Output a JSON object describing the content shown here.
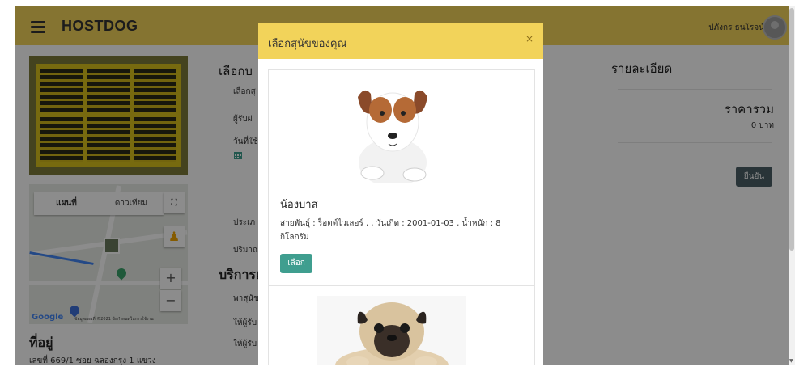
{
  "nav": {
    "brand": "HOSTDOG",
    "username": "ปภังกร ธนโรจน์"
  },
  "map": {
    "tab_map": "แผนที่",
    "tab_satellite": "ดาวเทียม",
    "google": "Google",
    "attribution": "ข้อมูลแผนที่ ©2021  ข้อกำหนดในการใช้งาน"
  },
  "address": {
    "title": "ที่อยู่",
    "text": "เลขที่ 669/1 ซอย ฉลองกรุง 1 แขวง"
  },
  "form": {
    "heading": "เลือกบ",
    "labels": [
      "เลือกสุ",
      "ผู้รับฝ",
      "วันที่ใช้",
      "ประเภ",
      "ปริมาณ"
    ],
    "section_title": "บริการเ",
    "service_labels": [
      "พาสุนัข",
      "ให้ผู้รับ",
      "ให้ผู้รับ"
    ]
  },
  "details": {
    "title": "รายละเอียด",
    "total_title": "ราคารวม",
    "total_value": "0 บาท",
    "confirm": "ยืนยัน"
  },
  "modal": {
    "title": "เลือกสุนัขของคุณ",
    "close": "×",
    "dogs": [
      {
        "name": "น้องบาส",
        "info": "สายพันธุ์ : ร็อตต์ไวเลอร์ , , วันเกิด : 2001-01-03 , น้ำหนัก : 8 กิโลกรัม",
        "select": "เลือก"
      }
    ]
  },
  "colors": {
    "navbar": "#f2d35a",
    "primary_button": "#3f9e8f",
    "confirm_button": "#4b6066"
  }
}
